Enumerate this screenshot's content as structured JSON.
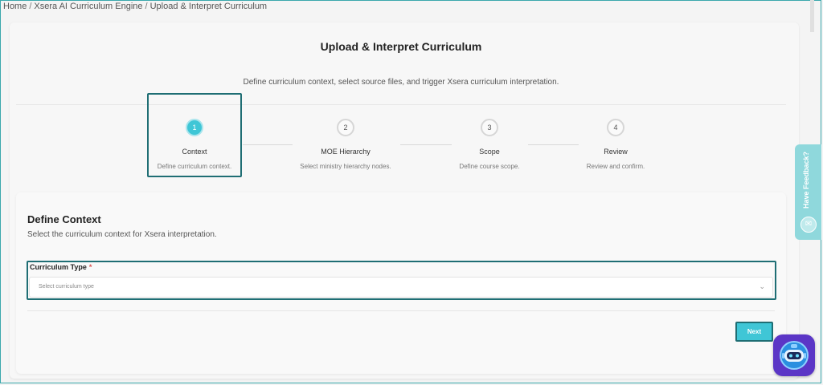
{
  "breadcrumb": {
    "items": [
      "Home",
      "Xsera AI Curriculum Engine",
      "Upload & Interpret Curriculum"
    ],
    "separator": "/"
  },
  "header": {
    "title": "Upload & Interpret Curriculum",
    "subtitle": "Define curriculum context, select source files, and trigger Xsera curriculum interpretation."
  },
  "steps": [
    {
      "number": "1",
      "label": "Context",
      "description": "Define curriculum context.",
      "active": true
    },
    {
      "number": "2",
      "label": "MOE Hierarchy",
      "description": "Select ministry hierarchy nodes.",
      "active": false
    },
    {
      "number": "3",
      "label": "Scope",
      "description": "Define course scope.",
      "active": false
    },
    {
      "number": "4",
      "label": "Review",
      "description": "Review and confirm.",
      "active": false
    }
  ],
  "section": {
    "title": "Define Context",
    "subtitle": "Select the curriculum context for Xsera interpretation."
  },
  "curriculum_type": {
    "label": "Curriculum Type",
    "required_mark": "*",
    "placeholder": "Select curriculum type",
    "icon": "chevron-down-icon"
  },
  "actions": {
    "next_label": "Next"
  },
  "feedback": {
    "label": "Have Feedback?",
    "icon": "feedback-icon"
  },
  "assistant": {
    "icon": "robot-assistant-icon"
  },
  "colors": {
    "accent": "#3fc6d6",
    "highlight_border": "#1f6e74",
    "required": "#d9534f",
    "feedback_tab": "#8fd8dc",
    "assistant_bg": "#5b36c6"
  }
}
